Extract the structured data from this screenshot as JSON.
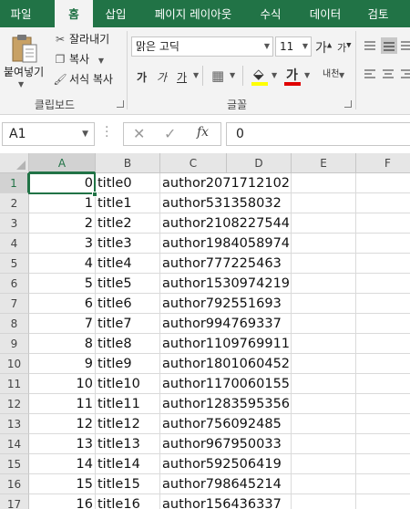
{
  "tabs": [
    {
      "label": "파일",
      "active": false
    },
    {
      "label": "홈",
      "active": true
    },
    {
      "label": "삽입",
      "active": false
    },
    {
      "label": "페이지 레이아웃",
      "active": false
    },
    {
      "label": "수식",
      "active": false
    },
    {
      "label": "데이터",
      "active": false
    },
    {
      "label": "검토",
      "active": false
    }
  ],
  "clipboard": {
    "paste_label": "붙여넣기",
    "cut_label": "잘라내기",
    "copy_label": "복사",
    "format_painter_label": "서식 복사",
    "group_label": "클립보드"
  },
  "font": {
    "name": "맑은 고딕",
    "size": "11",
    "grow_label": "가",
    "shrink_label": "가",
    "bold": "가",
    "italic": "가",
    "underline": "가",
    "font_color_glyph": "가",
    "phonetic_label": "내천",
    "group_label": "글꼴",
    "font_color": "#e00000",
    "fill_color": "#ffff00"
  },
  "formula_bar": {
    "name_box": "A1",
    "fx_label": "fx",
    "value": "0"
  },
  "columns": [
    "A",
    "B",
    "C",
    "D",
    "E",
    "F"
  ],
  "selected_column": "A",
  "selected_row": "1",
  "rows": [
    {
      "num": "1",
      "a": "0",
      "b": "title0",
      "c": "author2071712102"
    },
    {
      "num": "2",
      "a": "1",
      "b": "title1",
      "c": "author531358032"
    },
    {
      "num": "3",
      "a": "2",
      "b": "title2",
      "c": "author2108227544"
    },
    {
      "num": "4",
      "a": "3",
      "b": "title3",
      "c": "author1984058974"
    },
    {
      "num": "5",
      "a": "4",
      "b": "title4",
      "c": "author777225463"
    },
    {
      "num": "6",
      "a": "5",
      "b": "title5",
      "c": "author1530974219"
    },
    {
      "num": "7",
      "a": "6",
      "b": "title6",
      "c": "author792551693"
    },
    {
      "num": "8",
      "a": "7",
      "b": "title7",
      "c": "author994769337"
    },
    {
      "num": "9",
      "a": "8",
      "b": "title8",
      "c": "author1109769911"
    },
    {
      "num": "10",
      "a": "9",
      "b": "title9",
      "c": "author1801060452"
    },
    {
      "num": "11",
      "a": "10",
      "b": "title10",
      "c": "author1170060155"
    },
    {
      "num": "12",
      "a": "11",
      "b": "title11",
      "c": "author1283595356"
    },
    {
      "num": "13",
      "a": "12",
      "b": "title12",
      "c": "author756092485"
    },
    {
      "num": "14",
      "a": "13",
      "b": "title13",
      "c": "author967950033"
    },
    {
      "num": "15",
      "a": "14",
      "b": "title14",
      "c": "author592506419"
    },
    {
      "num": "16",
      "a": "15",
      "b": "title15",
      "c": "author798645214"
    },
    {
      "num": "17",
      "a": "16",
      "b": "title16",
      "c": "author156436337"
    }
  ]
}
